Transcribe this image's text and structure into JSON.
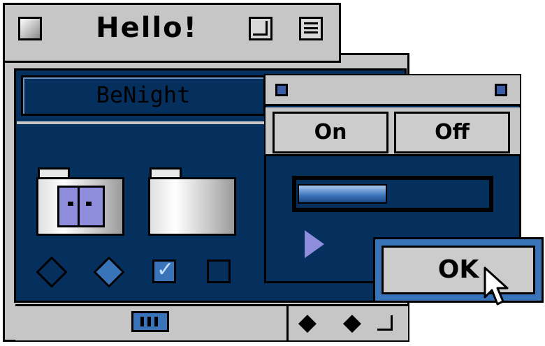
{
  "window": {
    "title": "Hello!",
    "close_icon": "close-box-icon",
    "zoom_icon": "zoom-box-icon",
    "collapse_icon": "collapse-box-icon",
    "field_text": "BeNight"
  },
  "icons": {
    "folders": [
      "finder-folder-icon",
      "folder-icon"
    ],
    "controls": [
      "radio-unchecked-icon",
      "radio-checked-icon",
      "checkbox-checked-icon",
      "checkbox-unchecked-icon"
    ],
    "status": "grid-icon",
    "nav": [
      "arrow-left-icon",
      "arrow-right-icon"
    ]
  },
  "dialog": {
    "segments": [
      "On",
      "Off"
    ],
    "progress": 0.47,
    "ok_label": "OK"
  },
  "colors": {
    "accent": "#05305e",
    "highlight": "#3a74b8",
    "chrome": "#c6c6c6"
  }
}
